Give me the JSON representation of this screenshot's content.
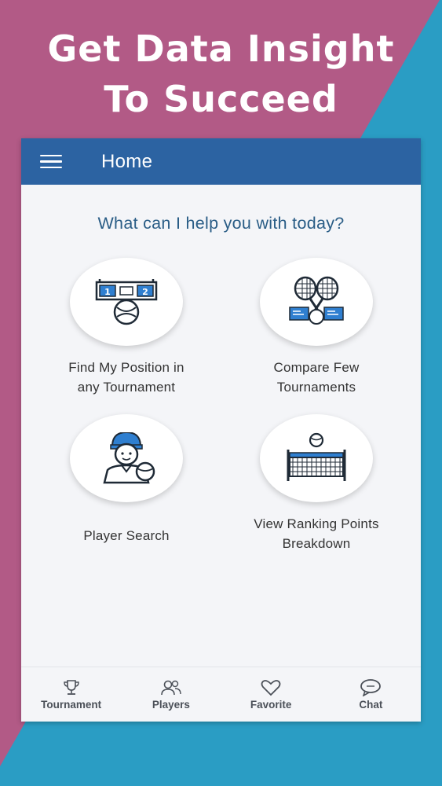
{
  "promo": {
    "headline_line1": "Get Data Insight",
    "headline_line2": "To Succeed",
    "colors": {
      "magenta": "#b25a86",
      "teal": "#2a9dc4"
    }
  },
  "appbar": {
    "menu_icon": "hamburger-menu-icon",
    "title": "Home",
    "color": "#2c63a2"
  },
  "main": {
    "question": "What can I help you with today?",
    "cards": [
      {
        "icon": "scoreboard-tennis-ball-icon",
        "line1": "Find My Position in",
        "line2": "any Tournament"
      },
      {
        "icon": "crossed-rackets-icon",
        "line1": "Compare Few",
        "line2": "Tournaments"
      },
      {
        "icon": "tennis-player-icon",
        "line1": "Player Search",
        "line2": ""
      },
      {
        "icon": "tennis-net-ball-icon",
        "line1": "View Ranking Points",
        "line2": "Breakdown"
      }
    ]
  },
  "bottom_nav": {
    "items": [
      {
        "icon": "trophy-icon",
        "label": "Tournament"
      },
      {
        "icon": "users-icon",
        "label": "Players"
      },
      {
        "icon": "heart-icon",
        "label": "Favorite"
      },
      {
        "icon": "chat-bubble-icon",
        "label": "Chat"
      }
    ]
  }
}
